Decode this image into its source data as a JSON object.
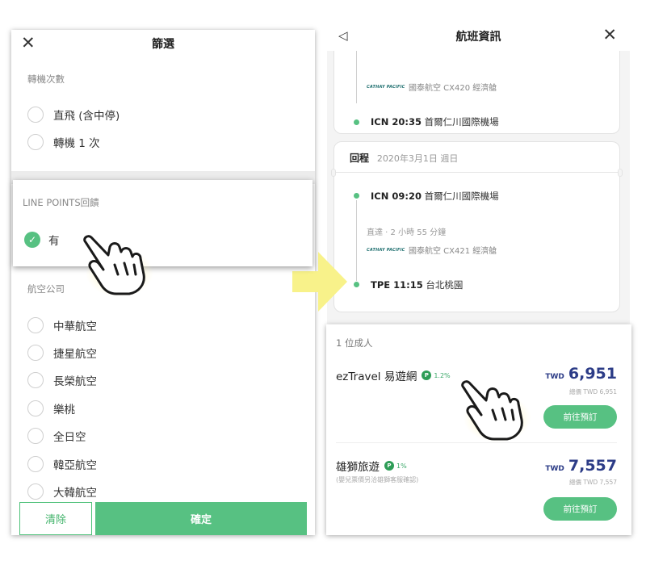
{
  "filter": {
    "title": "篩選",
    "stops_label": "轉機次數",
    "stops_options": [
      "直飛 (含中停)",
      "轉機 1 次"
    ],
    "points_label": "LINE POINTS回饋",
    "points_option": "有",
    "airline_label": "航空公司",
    "airlines": [
      "中華航空",
      "捷星航空",
      "長榮航空",
      "樂桃",
      "全日空",
      "韓亞航空",
      "大韓航空"
    ],
    "clear_label": "清除",
    "confirm_label": "確定"
  },
  "flight_info": {
    "title": "航班資訊",
    "outbound": {
      "airline_logo": "CATHAY PACIFIC",
      "airline_text": "國泰航空  CX420  經濟艙",
      "arrival_code_time": "ICN 20:35",
      "arrival_airport": "首爾仁川國際機場"
    },
    "return": {
      "label": "回程",
      "date": "2020年3月1日 週日",
      "depart_code_time": "ICN 09:20",
      "depart_airport": "首爾仁川國際機場",
      "duration": "直達 · 2 小時 55 分鐘",
      "airline_logo": "CATHAY PACIFIC",
      "airline_text": "國泰航空  CX421  經濟艙",
      "arrival_code_time": "TPE 11:15",
      "arrival_airport": "台北桃園"
    }
  },
  "prices": {
    "adults": "1 位成人",
    "offers": [
      {
        "vendor": "ezTravel 易遊網",
        "points": "1.2%",
        "note": "",
        "currency": "TWD",
        "amount": "6,951",
        "total": "總價 TWD 6,951",
        "book_label": "前往預訂"
      },
      {
        "vendor": "雄獅旅遊",
        "points": "1%",
        "note": "(嬰兒票價另洽雄獅客服確認)",
        "currency": "TWD",
        "amount": "7,557",
        "total": "總價 TWD 7,557",
        "book_label": "前往預訂"
      }
    ]
  },
  "colors": {
    "accent": "#57c182",
    "price": "#2c3c87",
    "arrow": "#f8f28a"
  },
  "icons": [
    "close-icon",
    "back-icon",
    "check-icon",
    "points-badge-icon",
    "pointing-hand-icon",
    "arrow-right-icon"
  ]
}
